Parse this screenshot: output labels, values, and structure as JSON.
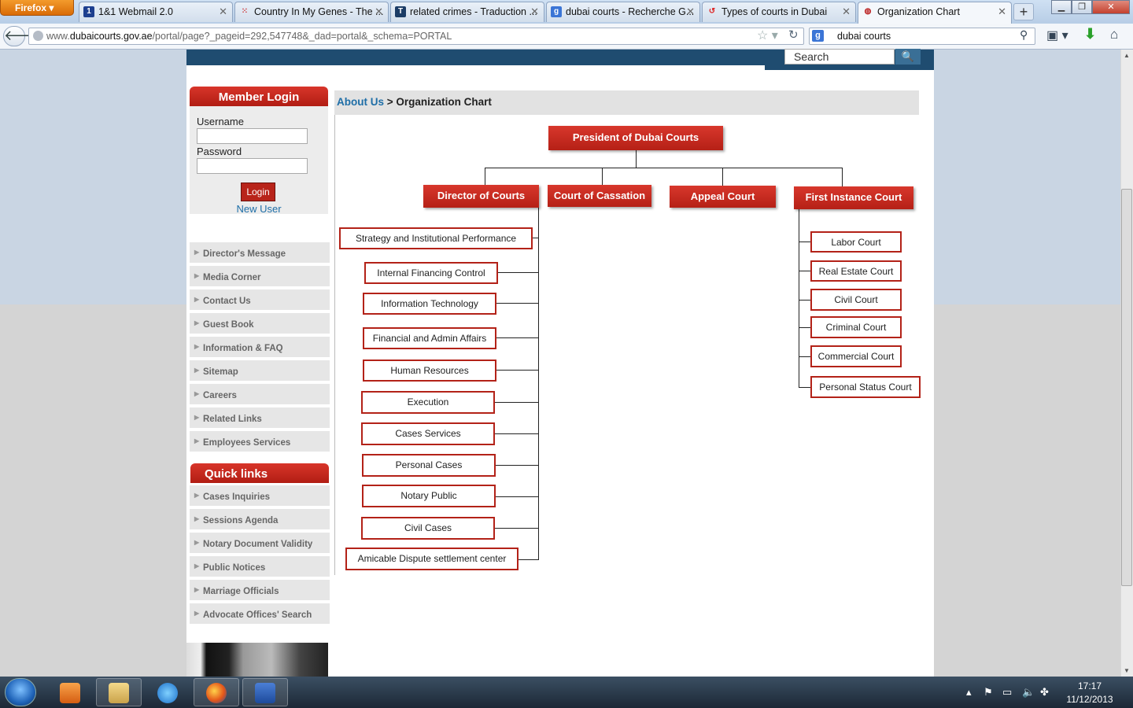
{
  "browser": {
    "menu_label": "Firefox",
    "tabs": [
      {
        "label": "1&1 Webmail 2.0",
        "icon": "1and1-favicon"
      },
      {
        "label": "Country In My Genes - The ...",
        "icon": "dots-favicon"
      },
      {
        "label": "related crimes - Traduction ...",
        "icon": "dictionary-favicon"
      },
      {
        "label": "dubai courts - Recherche G...",
        "icon": "google-favicon"
      },
      {
        "label": "Types of courts in Dubai",
        "icon": "red-swoosh-favicon"
      },
      {
        "label": "Organization Chart",
        "icon": "dubai-courts-favicon"
      }
    ],
    "url_prefix": "www.",
    "url_domain": "dubaicourts.gov.ae",
    "url_rest": "/portal/page?_pageid=292,547748&_dad=portal&_schema=PORTAL",
    "search_engine_letter": "g",
    "search_query": "dubai courts"
  },
  "site": {
    "search_placeholder": "Search",
    "login": {
      "title": "Member Login",
      "username_label": "Username",
      "password_label": "Password",
      "button": "Login",
      "new_user": "New User"
    },
    "menu": [
      "Director's Message",
      "Media Corner",
      "Contact Us",
      "Guest Book",
      "Information & FAQ",
      "Sitemap",
      "Careers",
      "Related Links",
      "Employees Services"
    ],
    "quick_links_title": "Quick links",
    "quick_links": [
      "Cases Inquiries",
      "Sessions Agenda",
      "Notary Document Validity",
      "Public Notices",
      "Marriage Officials",
      "Advocate Offices' Search"
    ],
    "breadcrumb": {
      "link": "About Us",
      "separator": ">",
      "current": "Organization Chart"
    }
  },
  "org_chart": {
    "top": "President of Dubai Courts",
    "level2": [
      "Director of Courts",
      "Court of Cassation",
      "Appeal Court",
      "First Instance Court"
    ],
    "director_units": [
      "Strategy and Institutional Performance",
      "Internal Financing Control",
      "Information Technology",
      "Financial and Admin Affairs",
      "Human Resources",
      "Execution",
      "Cases Services",
      "Personal Cases",
      "Notary Public",
      "Civil Cases",
      "Amicable Dispute settlement center"
    ],
    "first_instance_units": [
      "Labor Court",
      "Real Estate Court",
      "Civil Court",
      "Criminal Court",
      "Commercial Court",
      "Personal Status Court"
    ]
  },
  "taskbar": {
    "apps": [
      "media-player-icon",
      "file-explorer-icon",
      "internet-explorer-icon",
      "firefox-icon",
      "word-icon"
    ],
    "time": "17:17",
    "date": "11/12/2013"
  },
  "colors": {
    "brand_red": "#b52016",
    "link_blue": "#1e6ea7",
    "header_navy": "#1f4c70"
  }
}
